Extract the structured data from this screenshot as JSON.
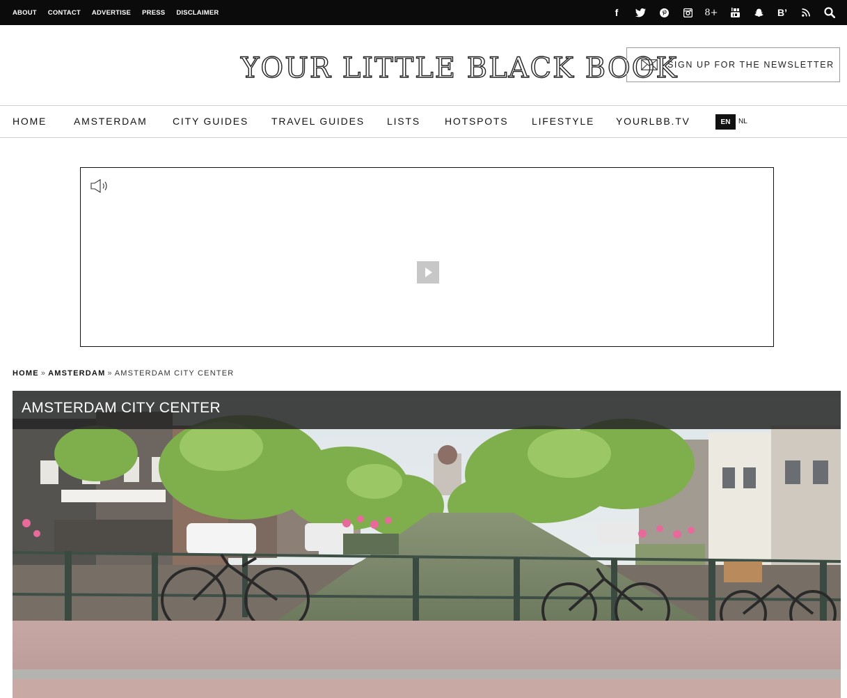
{
  "topbar": {
    "links": [
      "ABOUT",
      "CONTACT",
      "ADVERTISE",
      "PRESS",
      "DISCLAIMER"
    ],
    "social": [
      {
        "icon": "facebook-icon",
        "label": "f"
      },
      {
        "icon": "twitter-icon",
        "label": ""
      },
      {
        "icon": "pinterest-icon",
        "label": ""
      },
      {
        "icon": "instagram-icon",
        "label": ""
      },
      {
        "icon": "google-plus-icon",
        "label": "8+"
      },
      {
        "icon": "youtube-icon",
        "label": ""
      },
      {
        "icon": "snapchat-icon",
        "label": ""
      },
      {
        "icon": "bloglovin-icon",
        "label": "B’"
      },
      {
        "icon": "rss-icon",
        "label": ""
      },
      {
        "icon": "search-icon",
        "label": ""
      }
    ]
  },
  "header": {
    "logo": "YOUR LITTLE BLACK BOOK",
    "newsletter_label": "SIGN UP FOR THE NEWSLETTER"
  },
  "nav": {
    "items": [
      "HOME",
      "AMSTERDAM",
      "CITY GUIDES",
      "TRAVEL GUIDES",
      "LISTS",
      "HOTSPOTS",
      "LIFESTYLE",
      "YOURLBB.TV"
    ],
    "lang_active": "EN",
    "lang_other": "NL"
  },
  "breadcrumb": {
    "home": "HOME",
    "section": "AMSTERDAM",
    "separator": "»",
    "current": "AMSTERDAM CITY CENTER"
  },
  "hero": {
    "title": "AMSTERDAM CITY CENTER"
  },
  "colors": {
    "topbar_bg": "#0b0b0b",
    "title_bar": "#262626"
  }
}
